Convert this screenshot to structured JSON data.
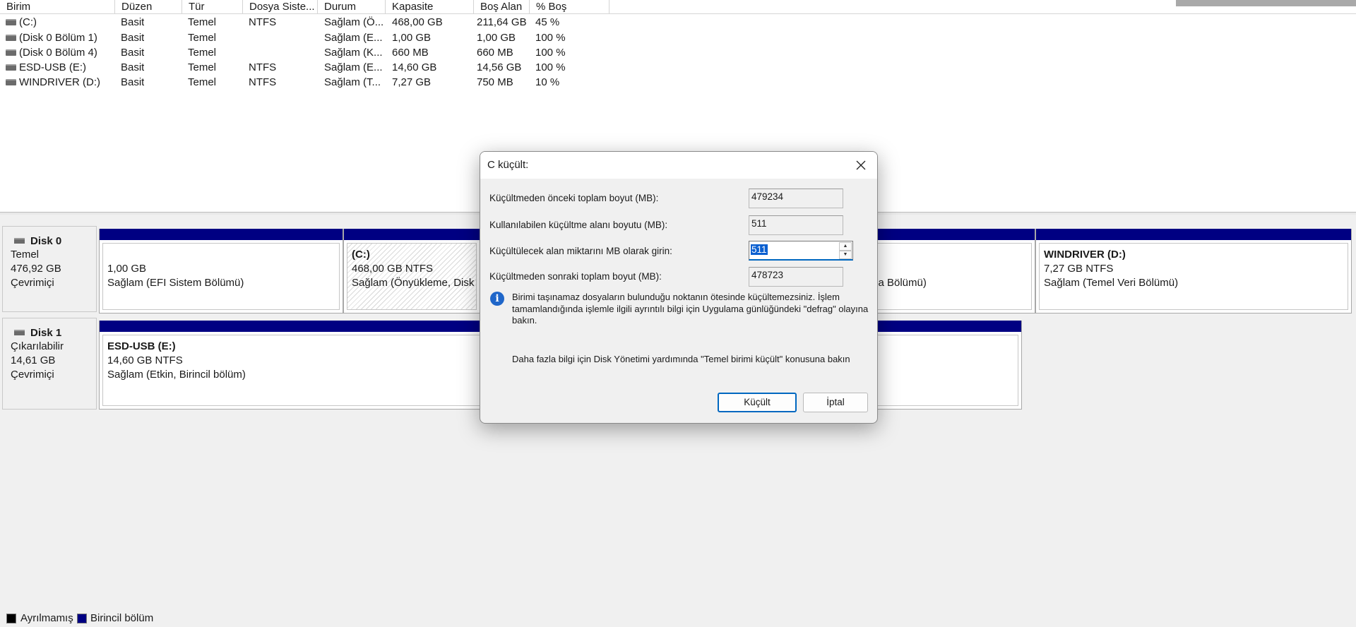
{
  "volume_list": {
    "columns": [
      "Birim",
      "Düzen",
      "Tür",
      "Dosya Siste...",
      "Durum",
      "Kapasite",
      "Boş Alan",
      "% Boş"
    ],
    "rows": [
      {
        "birim": "(C:)",
        "duzen": "Basit",
        "tur": "Temel",
        "dosya": "NTFS",
        "durum": "Sağlam (Ö...",
        "kapasite": "468,00 GB",
        "bos": "211,64 GB",
        "yuzde": "45 %"
      },
      {
        "birim": "(Disk 0 Bölüm 1)",
        "duzen": "Basit",
        "tur": "Temel",
        "dosya": "",
        "durum": "Sağlam (E...",
        "kapasite": "1,00 GB",
        "bos": "1,00 GB",
        "yuzde": "100 %"
      },
      {
        "birim": "(Disk 0 Bölüm 4)",
        "duzen": "Basit",
        "tur": "Temel",
        "dosya": "",
        "durum": "Sağlam (K...",
        "kapasite": "660 MB",
        "bos": "660 MB",
        "yuzde": "100 %"
      },
      {
        "birim": "ESD-USB (E:)",
        "duzen": "Basit",
        "tur": "Temel",
        "dosya": "NTFS",
        "durum": "Sağlam (E...",
        "kapasite": "14,60 GB",
        "bos": "14,56 GB",
        "yuzde": "100 %"
      },
      {
        "birim": "WINDRIVER (D:)",
        "duzen": "Basit",
        "tur": "Temel",
        "dosya": "NTFS",
        "durum": "Sağlam (T...",
        "kapasite": "7,27 GB",
        "bos": "750 MB",
        "yuzde": "10 %"
      }
    ]
  },
  "disks": {
    "disk0": {
      "name": "Disk 0",
      "type": "Temel",
      "size": "476,92 GB",
      "status": "Çevrimiçi",
      "partitions": {
        "p1": {
          "size": "1,00 GB",
          "status": "Sağlam (EFI Sistem Bölümü)"
        },
        "c": {
          "name": "(C:)",
          "size": "468,00 GB NTFS",
          "status": "Sağlam (Önyükleme, Disk B"
        },
        "p4": {
          "status": "rma Bölümü)"
        },
        "d": {
          "name": "WINDRIVER  (D:)",
          "size": "7,27 GB NTFS",
          "status": "Sağlam (Temel Veri Bölümü)"
        }
      }
    },
    "disk1": {
      "name": "Disk 1",
      "type": "Çıkarılabilir",
      "size": "14,61 GB",
      "status": "Çevrimiçi",
      "partitions": {
        "e": {
          "name": "ESD-USB  (E:)",
          "size": "14,60 GB NTFS",
          "status": "Sağlam (Etkin, Birincil bölüm)"
        }
      }
    }
  },
  "legend": {
    "unallocated": "Ayrılmamış",
    "primary": "Birincil bölüm",
    "colors": {
      "unallocated": "#000000",
      "primary": "#000082"
    }
  },
  "dialog": {
    "title": "C küçült:",
    "fields": {
      "total_before_label": "Küçültmeden önceki toplam boyut (MB):",
      "total_before_value": "479234",
      "available_label": "Kullanılabilen küçültme alanı boyutu (MB):",
      "available_value": "511",
      "amount_label": "Küçültülecek alan miktarını MB olarak girin:",
      "amount_value": "511",
      "total_after_label": "Küçültmeden sonraki toplam boyut (MB):",
      "total_after_value": "478723"
    },
    "info": "Birimi taşınamaz dosyaların bulunduğu noktanın ötesinde küçültemezsiniz. İşlem tamamlandığında işlemle ilgili ayrıntılı bilgi için Uygulama günlüğündeki \"defrag\" olayına bakın.",
    "help": "Daha fazla bilgi için Disk Yönetimi yardımında \"Temel birimi küçült\" konusuna bakın",
    "shrink_label": "Küçült",
    "cancel_label": "İptal",
    "accent": "#0067c0"
  }
}
